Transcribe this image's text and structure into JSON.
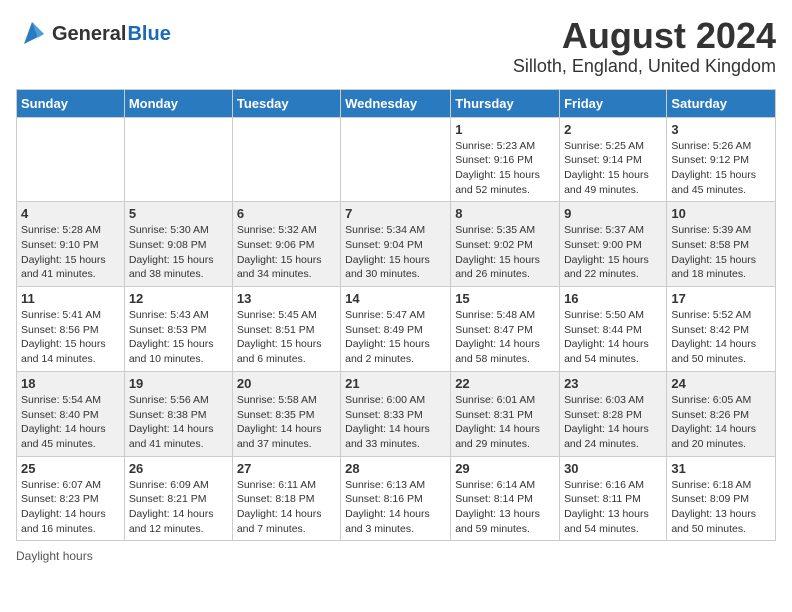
{
  "header": {
    "logo_general": "General",
    "logo_blue": "Blue",
    "title": "August 2024",
    "subtitle": "Silloth, England, United Kingdom"
  },
  "days_of_week": [
    "Sunday",
    "Monday",
    "Tuesday",
    "Wednesday",
    "Thursday",
    "Friday",
    "Saturday"
  ],
  "weeks": [
    [
      {
        "num": "",
        "info": ""
      },
      {
        "num": "",
        "info": ""
      },
      {
        "num": "",
        "info": ""
      },
      {
        "num": "",
        "info": ""
      },
      {
        "num": "1",
        "info": "Sunrise: 5:23 AM\nSunset: 9:16 PM\nDaylight: 15 hours\nand 52 minutes."
      },
      {
        "num": "2",
        "info": "Sunrise: 5:25 AM\nSunset: 9:14 PM\nDaylight: 15 hours\nand 49 minutes."
      },
      {
        "num": "3",
        "info": "Sunrise: 5:26 AM\nSunset: 9:12 PM\nDaylight: 15 hours\nand 45 minutes."
      }
    ],
    [
      {
        "num": "4",
        "info": "Sunrise: 5:28 AM\nSunset: 9:10 PM\nDaylight: 15 hours\nand 41 minutes."
      },
      {
        "num": "5",
        "info": "Sunrise: 5:30 AM\nSunset: 9:08 PM\nDaylight: 15 hours\nand 38 minutes."
      },
      {
        "num": "6",
        "info": "Sunrise: 5:32 AM\nSunset: 9:06 PM\nDaylight: 15 hours\nand 34 minutes."
      },
      {
        "num": "7",
        "info": "Sunrise: 5:34 AM\nSunset: 9:04 PM\nDaylight: 15 hours\nand 30 minutes."
      },
      {
        "num": "8",
        "info": "Sunrise: 5:35 AM\nSunset: 9:02 PM\nDaylight: 15 hours\nand 26 minutes."
      },
      {
        "num": "9",
        "info": "Sunrise: 5:37 AM\nSunset: 9:00 PM\nDaylight: 15 hours\nand 22 minutes."
      },
      {
        "num": "10",
        "info": "Sunrise: 5:39 AM\nSunset: 8:58 PM\nDaylight: 15 hours\nand 18 minutes."
      }
    ],
    [
      {
        "num": "11",
        "info": "Sunrise: 5:41 AM\nSunset: 8:56 PM\nDaylight: 15 hours\nand 14 minutes."
      },
      {
        "num": "12",
        "info": "Sunrise: 5:43 AM\nSunset: 8:53 PM\nDaylight: 15 hours\nand 10 minutes."
      },
      {
        "num": "13",
        "info": "Sunrise: 5:45 AM\nSunset: 8:51 PM\nDaylight: 15 hours\nand 6 minutes."
      },
      {
        "num": "14",
        "info": "Sunrise: 5:47 AM\nSunset: 8:49 PM\nDaylight: 15 hours\nand 2 minutes."
      },
      {
        "num": "15",
        "info": "Sunrise: 5:48 AM\nSunset: 8:47 PM\nDaylight: 14 hours\nand 58 minutes."
      },
      {
        "num": "16",
        "info": "Sunrise: 5:50 AM\nSunset: 8:44 PM\nDaylight: 14 hours\nand 54 minutes."
      },
      {
        "num": "17",
        "info": "Sunrise: 5:52 AM\nSunset: 8:42 PM\nDaylight: 14 hours\nand 50 minutes."
      }
    ],
    [
      {
        "num": "18",
        "info": "Sunrise: 5:54 AM\nSunset: 8:40 PM\nDaylight: 14 hours\nand 45 minutes."
      },
      {
        "num": "19",
        "info": "Sunrise: 5:56 AM\nSunset: 8:38 PM\nDaylight: 14 hours\nand 41 minutes."
      },
      {
        "num": "20",
        "info": "Sunrise: 5:58 AM\nSunset: 8:35 PM\nDaylight: 14 hours\nand 37 minutes."
      },
      {
        "num": "21",
        "info": "Sunrise: 6:00 AM\nSunset: 8:33 PM\nDaylight: 14 hours\nand 33 minutes."
      },
      {
        "num": "22",
        "info": "Sunrise: 6:01 AM\nSunset: 8:31 PM\nDaylight: 14 hours\nand 29 minutes."
      },
      {
        "num": "23",
        "info": "Sunrise: 6:03 AM\nSunset: 8:28 PM\nDaylight: 14 hours\nand 24 minutes."
      },
      {
        "num": "24",
        "info": "Sunrise: 6:05 AM\nSunset: 8:26 PM\nDaylight: 14 hours\nand 20 minutes."
      }
    ],
    [
      {
        "num": "25",
        "info": "Sunrise: 6:07 AM\nSunset: 8:23 PM\nDaylight: 14 hours\nand 16 minutes."
      },
      {
        "num": "26",
        "info": "Sunrise: 6:09 AM\nSunset: 8:21 PM\nDaylight: 14 hours\nand 12 minutes."
      },
      {
        "num": "27",
        "info": "Sunrise: 6:11 AM\nSunset: 8:18 PM\nDaylight: 14 hours\nand 7 minutes."
      },
      {
        "num": "28",
        "info": "Sunrise: 6:13 AM\nSunset: 8:16 PM\nDaylight: 14 hours\nand 3 minutes."
      },
      {
        "num": "29",
        "info": "Sunrise: 6:14 AM\nSunset: 8:14 PM\nDaylight: 13 hours\nand 59 minutes."
      },
      {
        "num": "30",
        "info": "Sunrise: 6:16 AM\nSunset: 8:11 PM\nDaylight: 13 hours\nand 54 minutes."
      },
      {
        "num": "31",
        "info": "Sunrise: 6:18 AM\nSunset: 8:09 PM\nDaylight: 13 hours\nand 50 minutes."
      }
    ]
  ],
  "footer": {
    "daylight_label": "Daylight hours"
  }
}
